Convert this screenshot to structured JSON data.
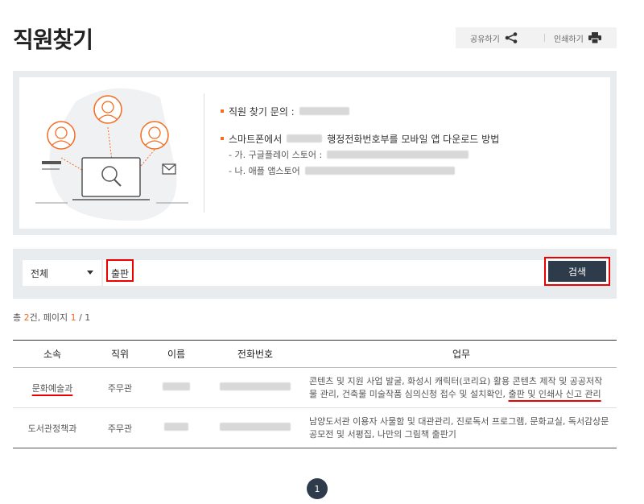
{
  "page": {
    "title": "직원찾기"
  },
  "utility": {
    "share_label": "공유하기",
    "print_label": "인쇄하기"
  },
  "info": {
    "inquiry_label": "직원 찾기 문의 :",
    "download_label_pre": "스마트폰에서",
    "download_label_post": "행정전화번호부를 모바일 앱 다운로드 방법",
    "google_label": "- 가. 구글플레이 스토어 :",
    "apple_label": "- 나. 애플 앱스토어"
  },
  "search": {
    "scope_value": "전체",
    "query_value": "출판",
    "button_label": "검색"
  },
  "summary": {
    "prefix": "총 ",
    "count": "2",
    "middle": "건, 페이지 ",
    "current_page": "1",
    "total_pages": " / 1"
  },
  "table": {
    "headers": {
      "dept": "소속",
      "position": "직위",
      "name": "이름",
      "phone": "전화번호",
      "duty": "업무"
    },
    "rows": [
      {
        "dept": "문화예술과",
        "position": "주무관",
        "duty_pre": "콘텐츠 및 지원 사업 발굴, 화성시 캐릭터(코리요) 활용 콘텐츠 제작 및 공공저작물 관리, 건축물 미술작품 심의신청 접수 및 설치확인, ",
        "duty_hl": "출판 및 인쇄사 신고 관리"
      },
      {
        "dept": "도서관정책과",
        "position": "주무관",
        "duty_pre": "남양도서관 이용자 사물함 및 대관관리, 진로독서 프로그램, 문화교실, 독서감상문 공모전 및 서평집, 나만의 그림책 출판기",
        "duty_hl": ""
      }
    ]
  },
  "pagination": {
    "current": "1"
  },
  "colors": {
    "accent": "#f26c21",
    "dark_button": "#2e3b4a",
    "highlight_red": "#e00000",
    "panel_bg": "#e9ecef"
  }
}
